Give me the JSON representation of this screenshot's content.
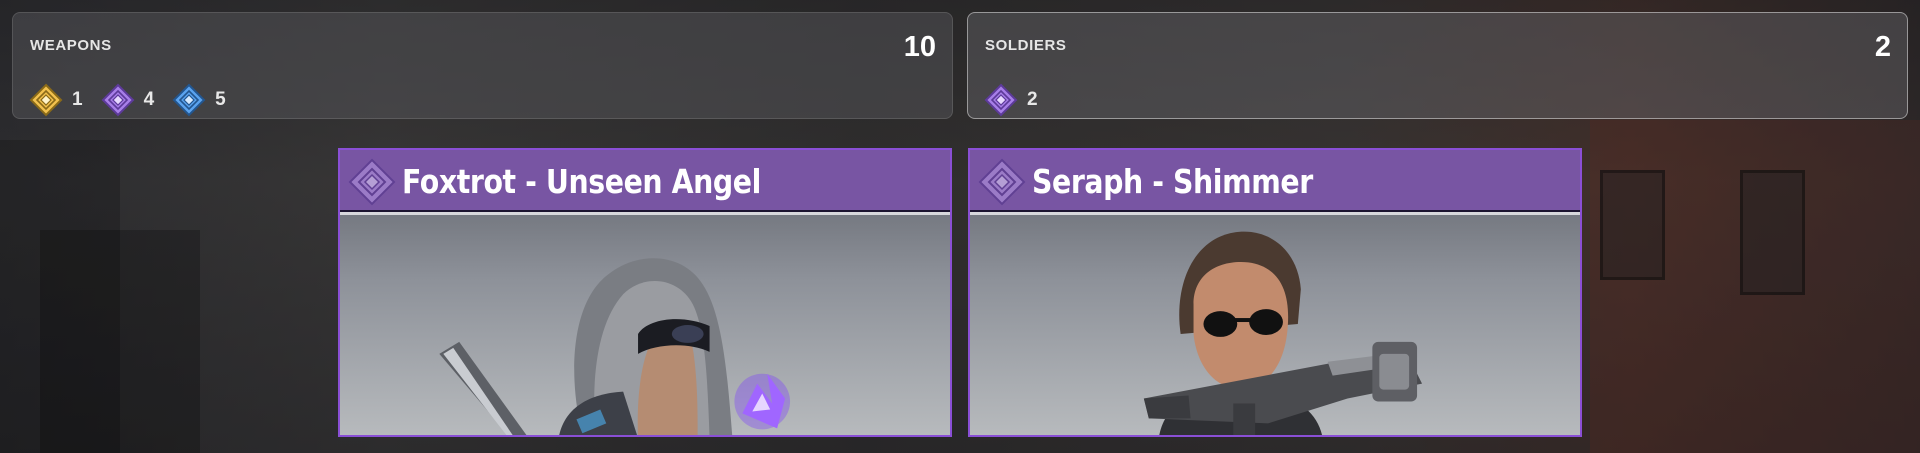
{
  "summary": {
    "weapons": {
      "title": "WEAPONS",
      "total": "10",
      "rarities": [
        {
          "icon": "legendary-rarity-icon",
          "color": "#f2c14e",
          "count": "1"
        },
        {
          "icon": "epic-rarity-icon",
          "color": "#a77ee8",
          "count": "4"
        },
        {
          "icon": "rare-rarity-icon",
          "color": "#5aa3ef",
          "count": "5"
        }
      ]
    },
    "soldiers": {
      "title": "SOLDIERS",
      "total": "2",
      "rarities": [
        {
          "icon": "epic-rarity-icon",
          "color": "#a77ee8",
          "count": "2"
        }
      ]
    }
  },
  "cards": [
    {
      "title": "Foxtrot - Unseen Angel",
      "rarity_icon": "epic-rarity-icon",
      "border_color": "#8a4fd6",
      "header_color": "#7855a3"
    },
    {
      "title": "Seraph - Shimmer",
      "rarity_icon": "epic-rarity-icon",
      "border_color": "#8a4fd6",
      "header_color": "#7855a3"
    }
  ]
}
